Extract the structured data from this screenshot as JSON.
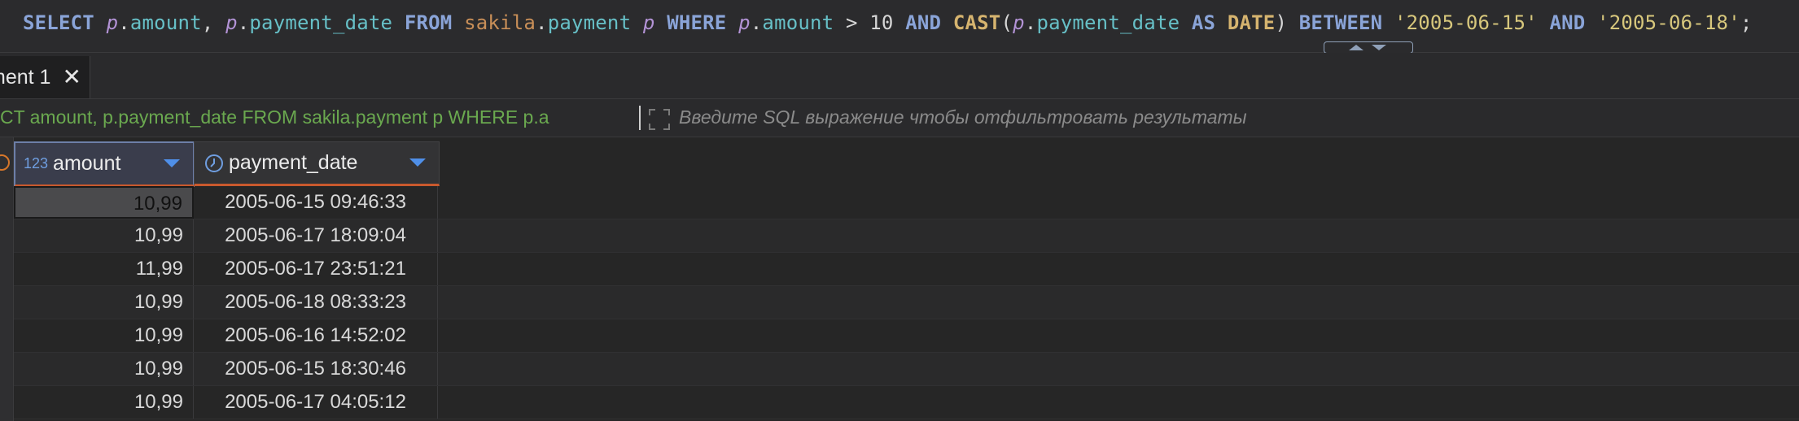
{
  "editor": {
    "sql": [
      {
        "t": "SELECT",
        "c": "kw"
      },
      {
        "t": " ",
        "c": "punct"
      },
      {
        "t": "p",
        "c": "alias"
      },
      {
        "t": ".",
        "c": "punct"
      },
      {
        "t": "amount",
        "c": "col"
      },
      {
        "t": ", ",
        "c": "punct"
      },
      {
        "t": "p",
        "c": "alias"
      },
      {
        "t": ".",
        "c": "punct"
      },
      {
        "t": "payment_date",
        "c": "col"
      },
      {
        "t": " ",
        "c": "punct"
      },
      {
        "t": "FROM",
        "c": "kw"
      },
      {
        "t": " ",
        "c": "punct"
      },
      {
        "t": "sakila",
        "c": "schema"
      },
      {
        "t": ".",
        "c": "punct"
      },
      {
        "t": "payment",
        "c": "col"
      },
      {
        "t": " ",
        "c": "punct"
      },
      {
        "t": "p",
        "c": "alias"
      },
      {
        "t": " ",
        "c": "punct"
      },
      {
        "t": "WHERE",
        "c": "kw"
      },
      {
        "t": " ",
        "c": "punct"
      },
      {
        "t": "p",
        "c": "alias"
      },
      {
        "t": ".",
        "c": "punct"
      },
      {
        "t": "amount",
        "c": "col"
      },
      {
        "t": " > ",
        "c": "punct"
      },
      {
        "t": "10",
        "c": "num"
      },
      {
        "t": " ",
        "c": "punct"
      },
      {
        "t": "AND",
        "c": "kw"
      },
      {
        "t": " ",
        "c": "punct"
      },
      {
        "t": "CAST",
        "c": "kw2"
      },
      {
        "t": "(",
        "c": "punct"
      },
      {
        "t": "p",
        "c": "alias"
      },
      {
        "t": ".",
        "c": "punct"
      },
      {
        "t": "payment_date",
        "c": "col"
      },
      {
        "t": " ",
        "c": "punct"
      },
      {
        "t": "AS",
        "c": "kw"
      },
      {
        "t": " ",
        "c": "punct"
      },
      {
        "t": "DATE",
        "c": "kw2"
      },
      {
        "t": ") ",
        "c": "punct"
      },
      {
        "t": "BETWEEN",
        "c": "kw"
      },
      {
        "t": " ",
        "c": "punct"
      },
      {
        "t": "'2005-06-15'",
        "c": "str"
      },
      {
        "t": " ",
        "c": "punct"
      },
      {
        "t": "AND",
        "c": "kw"
      },
      {
        "t": " ",
        "c": "punct"
      },
      {
        "t": "'2005-06-18'",
        "c": "str"
      },
      {
        "t": ";",
        "c": "punct"
      }
    ]
  },
  "tab": {
    "label": "ment 1",
    "close_icon": "close-icon"
  },
  "filter": {
    "query": "CT amount, p.payment_date FROM sakila.payment p WHERE p.a",
    "placeholder": "Введите SQL выражение чтобы отфильтровать результаты",
    "expand_icon": "expand-icon"
  },
  "grid": {
    "columns": [
      {
        "type_badge": "123",
        "label": "amount"
      },
      {
        "type_badge": "clock-icon",
        "label": "payment_date"
      }
    ],
    "rows": [
      {
        "amount": "10,99",
        "payment_date": "2005-06-15 09:46:33"
      },
      {
        "amount": "10,99",
        "payment_date": "2005-06-17 18:09:04"
      },
      {
        "amount": "11,99",
        "payment_date": "2005-06-17 23:51:21"
      },
      {
        "amount": "10,99",
        "payment_date": "2005-06-18 08:33:23"
      },
      {
        "amount": "10,99",
        "payment_date": "2005-06-16 14:52:02"
      },
      {
        "amount": "10,99",
        "payment_date": "2005-06-15 18:30:46"
      },
      {
        "amount": "10,99",
        "payment_date": "2005-06-17 04:05:12"
      }
    ]
  },
  "colors": {
    "keyword": "#8aa4d8",
    "alias": "#b393d6",
    "column": "#67c0c7",
    "string": "#d7c77c",
    "filter_text": "#6aa84f",
    "header_accent": "#c9592d"
  }
}
